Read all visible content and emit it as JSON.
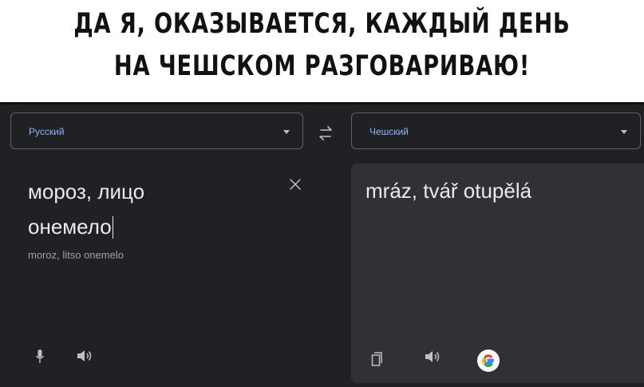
{
  "caption": {
    "line1": "ДА Я, ОКАЗЫВАЕТСЯ, КАЖДЫЙ ДЕНЬ",
    "line2": "НА ЧЕШСКОМ РАЗГОВАРИВАЮ!"
  },
  "translator": {
    "source_language": "Русский",
    "target_language": "Чешский",
    "source_text": "мороз, лицо онемело",
    "source_line1": "мороз, лицо",
    "source_line2": "онемело",
    "transliteration": "moroz, litso onemelo",
    "translated_text": "mráz, tvář otupělá"
  },
  "icons": {
    "swap": "swap-languages-icon",
    "clear": "close-icon",
    "mic": "microphone-icon",
    "listen_source": "speaker-icon",
    "copy": "copy-icon",
    "listen_target": "speaker-icon",
    "google": "google-logo-icon"
  },
  "colors": {
    "background": "#202124",
    "panel": "#303134",
    "accent": "#8ab4f8",
    "text": "#e8eaed",
    "muted": "#9aa0a6"
  }
}
